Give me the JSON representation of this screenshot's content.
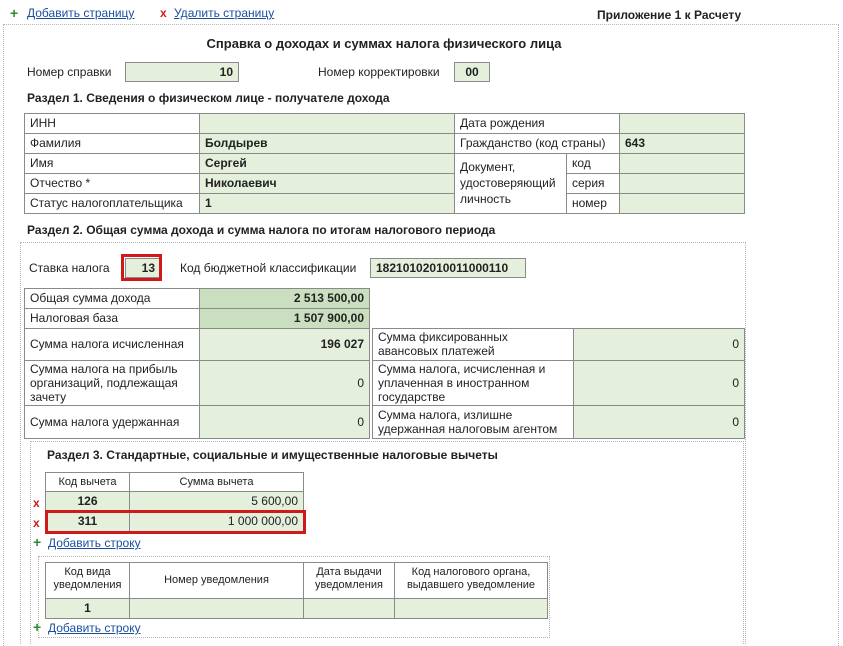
{
  "toolbar": {
    "add_page": "Добавить страницу",
    "delete_page": "Удалить страницу",
    "appendix": "Приложение 1 к Расчету"
  },
  "doc_title": "Справка о доходах и суммах налога физического лица",
  "header": {
    "cert_number_label": "Номер справки",
    "cert_number_value": "10",
    "correction_label": "Номер корректировки",
    "correction_value": "00"
  },
  "section1": {
    "title": "Раздел 1. Сведения о физическом лице - получателе дохода",
    "inn_label": "ИНН",
    "inn_value": "",
    "birth_label": "Дата рождения",
    "birth_value": "",
    "surname_label": "Фамилия",
    "surname_value": "Болдырев",
    "citizenship_label": "Гражданство (код страны)",
    "citizenship_value": "643",
    "name_label": "Имя",
    "name_value": "Сергей",
    "doc_label": "Документ, удостоверяющий личность",
    "doc_code_label": "код",
    "doc_series_label": "серия",
    "doc_number_label": "номер",
    "patronymic_label": "Отчество *",
    "patronymic_value": "Николаевич",
    "status_label": "Статус налогоплательщика",
    "status_value": "1"
  },
  "section2": {
    "title": "Раздел 2. Общая сумма дохода и сумма налога по итогам налогового периода",
    "rate_label": "Ставка налога",
    "rate_value": "13",
    "kbk_label": "Код бюджетной классификации",
    "kbk_value": "18210102010011000110",
    "total_income_label": "Общая сумма дохода",
    "total_income_value": "2 513 500,00",
    "tax_base_label": "Налоговая база",
    "tax_base_value": "1 507 900,00",
    "tax_calc_label": "Сумма налога исчисленная",
    "tax_calc_value": "196 027",
    "fixed_adv_label": "Сумма фиксированных авансовых платежей",
    "fixed_adv_value": "0",
    "profit_tax_label": "Сумма налога на прибыль организаций, подлежащая зачету",
    "profit_tax_value": "0",
    "foreign_tax_label": "Сумма налога, исчисленная и уплаченная в иностранном государстве",
    "foreign_tax_value": "0",
    "withheld_label": "Сумма налога удержанная",
    "withheld_value": "0",
    "overwithheld_label": "Сумма налога, излишне удержанная налоговым агентом",
    "overwithheld_value": "0"
  },
  "section3": {
    "title": "Раздел 3. Стандартные, социальные и имущественные налоговые вычеты",
    "col_code": "Код вычета",
    "col_amount": "Сумма вычета",
    "rows": [
      {
        "code": "126",
        "amount": "5 600,00"
      },
      {
        "code": "311",
        "amount": "1 000 000,00"
      }
    ],
    "add_row": "Добавить строку",
    "notice_cols": {
      "type_code": "Код вида уведомления",
      "number": "Номер уведомления",
      "date": "Дата выдачи уведомления",
      "authority": "Код налогового органа, выдавшего уведомление"
    },
    "notice_row": {
      "type_code": "1",
      "number": "",
      "date": "",
      "authority": ""
    },
    "add_row2": "Добавить строку"
  },
  "colors": {
    "link": "#1a4fa0",
    "field_green": "#e4efdc",
    "highlight_red": "#d01a1a",
    "add_green": "#2e8b2e"
  }
}
